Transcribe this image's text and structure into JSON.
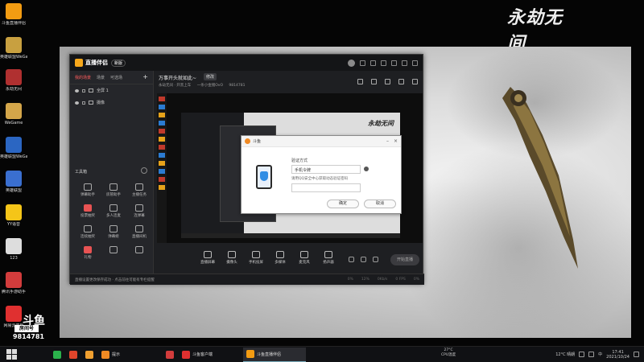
{
  "desktop": {
    "icons": [
      {
        "label": "斗鱼直播伴侣",
        "color": "#f39c12"
      },
      {
        "label": "英雄联盟WeGame版",
        "color": "#c8a040"
      },
      {
        "label": "永劫无间",
        "color": "#b03030"
      },
      {
        "label": "WeGame",
        "color": "#d4a64a"
      },
      {
        "label": "英雄联盟WeGame版",
        "color": "#2b66c2"
      },
      {
        "label": "英雄联盟",
        "color": "#3a6fd0"
      },
      {
        "label": "YY语音",
        "color": "#f5c518"
      },
      {
        "label": "123",
        "color": "#dddddd"
      },
      {
        "label": "腾讯手游助手",
        "color": "#d23c3c"
      },
      {
        "label": "网易云音乐",
        "color": "#e03030"
      }
    ],
    "game_logo": "永劫无间"
  },
  "app": {
    "logo_text": "直播伴侣",
    "version": "新版",
    "scene_tabs": [
      "我的场景",
      "场景",
      "可选场"
    ],
    "scene_plus": "+",
    "sources": [
      {
        "label": "全屏 1"
      },
      {
        "label": "摄像"
      }
    ],
    "toolbox_title": "工具箱",
    "tools": [
      {
        "label": "弹幕助手",
        "red": false
      },
      {
        "label": "房管助手",
        "red": false
      },
      {
        "label": "主播任务",
        "red": false
      },
      {
        "label": "投票抽奖",
        "red": true
      },
      {
        "label": "多人连麦",
        "red": false
      },
      {
        "label": "连弹幕",
        "red": false
      },
      {
        "label": "连续抽奖",
        "red": false
      },
      {
        "label": "弹幕姬",
        "red": false
      },
      {
        "label": "直播间机",
        "red": false
      },
      {
        "label": "礼物",
        "red": true
      },
      {
        "label": "",
        "red": false
      },
      {
        "label": "",
        "red": false
      }
    ],
    "room_title": "万事开头就如此~",
    "room_edit": "修改",
    "room_meta": [
      "永劫无间 · 开黑上车",
      "一条小金猪OvO",
      "9814781"
    ],
    "notice": "直播设置更改保存成功 · 点击前往可能有专栏提醒",
    "stats": [
      "0%",
      "12%",
      "0Kb/s",
      "0 FPS",
      "0%"
    ],
    "controls": [
      "直播屏幕",
      "摄像头",
      "手机投屏",
      "多媒体",
      "麦克风",
      "扬声器"
    ],
    "live_button": "开始直播"
  },
  "dialog": {
    "title": "斗鱼",
    "verify_label": "验证方式",
    "verify_value": "手机令牌",
    "verify_hint": "请用QQ安全中心获取动态验证密码",
    "confirm": "确定",
    "cancel": "取消"
  },
  "preview": {
    "inner_logo": "永劫无间"
  },
  "streamer": {
    "brand": "斗鱼",
    "room_label": "房间号",
    "room_number": "9814781"
  },
  "taskbar": {
    "apps": [
      {
        "label": "",
        "color": "#2bb24c"
      },
      {
        "label": "",
        "color": "#e0452b"
      },
      {
        "label": "",
        "color": "#f0a030"
      },
      {
        "label": "提示",
        "color": "#f08a24",
        "wide": true,
        "active": false
      },
      {
        "label": "",
        "color": "#d23c3c"
      },
      {
        "label": "斗鱼客户端",
        "color": "#e03030",
        "wide": true,
        "active": false
      },
      {
        "label": "斗鱼直播伴侣",
        "color": "#f39c12",
        "wide": true,
        "active": true
      }
    ],
    "cpu_temp": "27°C",
    "cpu_label": "CPU温度",
    "weather": "12°C 晴朗",
    "ime": "中",
    "time": "17:41",
    "date": "2021/10/24"
  }
}
